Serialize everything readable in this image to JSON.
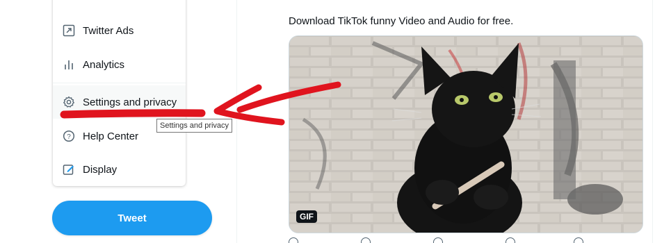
{
  "menu": {
    "items": [
      {
        "label": "Twitter Ads",
        "icon": "external-link-icon"
      },
      {
        "label": "Analytics",
        "icon": "analytics-icon"
      },
      {
        "label": "Settings and privacy",
        "icon": "gear-icon"
      },
      {
        "label": "Help Center",
        "icon": "help-icon"
      },
      {
        "label": "Display",
        "icon": "display-edit-icon"
      }
    ]
  },
  "tooltip": {
    "text": "Settings and privacy"
  },
  "tweet_button": {
    "label": "Tweet"
  },
  "tweet": {
    "text": "Download TikTok funny Video and Audio for free.",
    "media_badge": "GIF"
  },
  "colors": {
    "accent": "#1d9bf0",
    "annotation": "#e0141e"
  }
}
